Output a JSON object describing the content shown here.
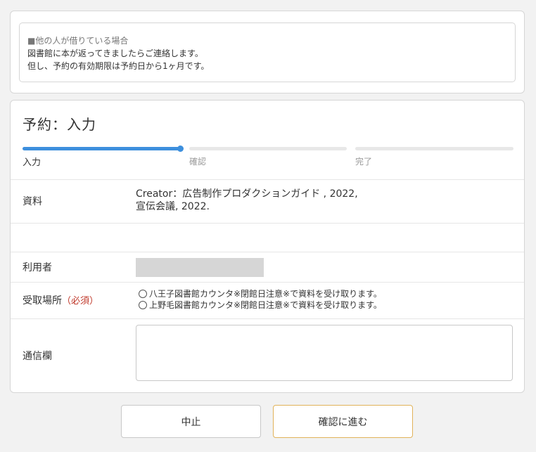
{
  "notice": {
    "title": "■他の人が借りている場合",
    "line1": "図書館に本が返ってきましたらご連絡します。",
    "line2": "但し、予約の有効期限は予約日から1ヶ月です。"
  },
  "form": {
    "title": "予約：入力",
    "steps": [
      {
        "label": "入力",
        "state": "active"
      },
      {
        "label": "確認",
        "state": "inactive"
      },
      {
        "label": "完了",
        "state": "inactive"
      }
    ],
    "material": {
      "label": "資料",
      "line1": "Creator：広告制作プロダクションガイド , 2022,",
      "line2": "宣伝会議, 2022."
    },
    "user": {
      "label": "利用者"
    },
    "pickup": {
      "label": "受取場所",
      "required": "（必須）",
      "options": [
        "八王子図書館カウンタ※閉館日注意※で資料を受け取ります。",
        "上野毛図書館カウンタ※閉館日注意※で資料を受け取ります。"
      ]
    },
    "comment": {
      "label": "通信欄",
      "value": ""
    }
  },
  "buttons": {
    "cancel": "中止",
    "confirm": "確認に進む"
  },
  "colors": {
    "accent": "#3d8fdd",
    "required": "#c0392b",
    "confirm_border": "#e1b35a"
  }
}
